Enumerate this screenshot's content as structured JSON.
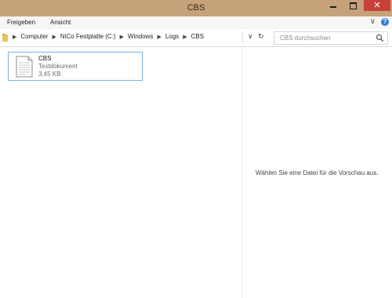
{
  "window": {
    "title": "CBS",
    "close_glyph": "✕",
    "title_bar_color": "#c6a27a",
    "close_button_color": "#c7413a"
  },
  "ribbon": {
    "tabs": [
      {
        "label": "Freigeben"
      },
      {
        "label": "Ansicht"
      }
    ],
    "expand_glyph": "∨",
    "help_glyph": "?"
  },
  "address": {
    "breadcrumbs": [
      {
        "label": "Computer"
      },
      {
        "label": "NiCo Festplatte (C:)"
      },
      {
        "label": "Windows"
      },
      {
        "label": "Logs"
      },
      {
        "label": "CBS"
      }
    ],
    "separator": "▶",
    "dropdown_glyph": "∨",
    "refresh_glyph": "↻"
  },
  "search": {
    "placeholder": "CBS durchsuchen"
  },
  "files": [
    {
      "name": "CBS",
      "type": "Textdokument",
      "size": "3,45 KB",
      "icon": "text-document-icon",
      "selected": true
    }
  ],
  "preview": {
    "message": "Wählen Sie eine Datei für die Vorschau aus."
  },
  "colors": {
    "accent": "#7db3e6",
    "help": "#2c7fd6"
  }
}
